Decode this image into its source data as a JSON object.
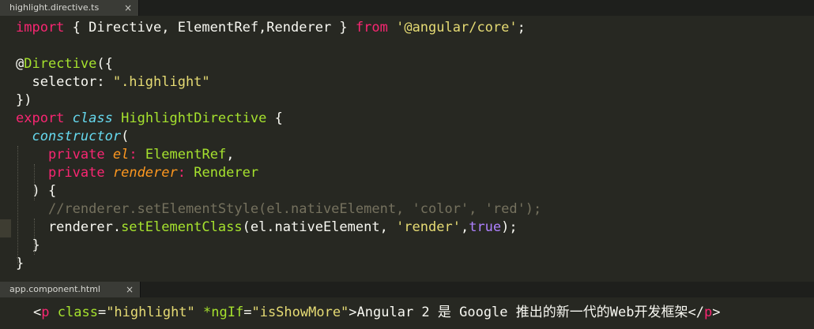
{
  "tabs": [
    {
      "label": "highlight.directive.ts",
      "close": "×"
    },
    {
      "label": "app.component.html",
      "close": "×"
    }
  ],
  "code": {
    "l1": {
      "t1": "import",
      "t2": " { Directive, ElementRef,Renderer } ",
      "t3": "from",
      "t4": " ",
      "t5": "'@angular/core'",
      "t6": ";"
    },
    "l3": {
      "t1": "@",
      "t2": "Directive",
      "t3": "({"
    },
    "l4": {
      "t1": "  selector: ",
      "t2": "\".highlight\""
    },
    "l5": {
      "t1": "})"
    },
    "l6": {
      "t1": "export",
      "t2": " ",
      "t3": "class",
      "t4": " ",
      "t5": "HighlightDirective",
      "t6": " {"
    },
    "l7": {
      "t1": "  ",
      "t2": "constructor",
      "t3": "("
    },
    "l8": {
      "t1": "    ",
      "t2": "private",
      "t3": " ",
      "t4": "el",
      "t5": ": ",
      "t6": "ElementRef",
      "t7": ","
    },
    "l9": {
      "t1": "    ",
      "t2": "private",
      "t3": " ",
      "t4": "renderer",
      "t5": ": ",
      "t6": "Renderer"
    },
    "l10": {
      "t1": "  ) {"
    },
    "l11": {
      "t1": "    ",
      "t2": "//renderer.setElementStyle(el.nativeElement, 'color', 'red');"
    },
    "l12": {
      "t1": "    renderer.",
      "t2": "setElementClass",
      "t3": "(el.nativeElement, ",
      "t4": "'render'",
      "t5": ",",
      "t6": "true",
      "t7": ");"
    },
    "l13": {
      "t1": "  }"
    },
    "l14": {
      "t1": "}"
    }
  },
  "html_line": {
    "t1": "<",
    "t2": "p",
    "t3": " ",
    "t4": "class",
    "t5": "=",
    "t6": "\"highlight\"",
    "t7": " ",
    "t8": "*ngIf",
    "t9": "=",
    "t10": "\"isShowMore\"",
    "t11": ">Angular 2 是 Google 推出的新一代的Web开发框架</",
    "t12": "p",
    "t13": ">"
  }
}
